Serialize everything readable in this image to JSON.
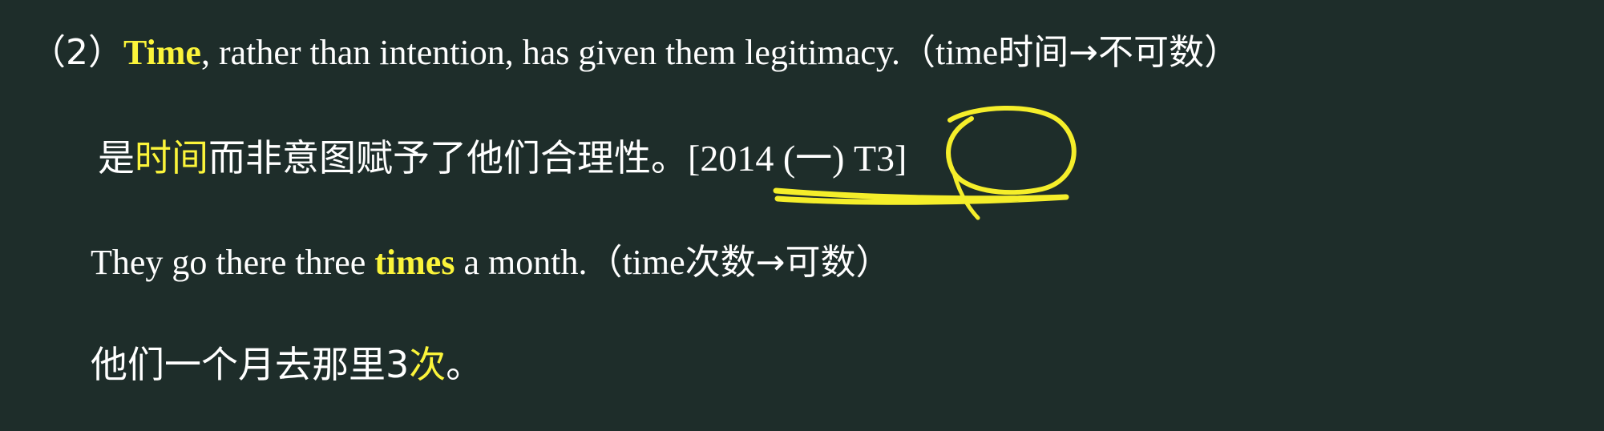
{
  "example1": {
    "number": "（2）",
    "keyword": "Time",
    "rest": ", rather than intention, has given them legitimacy.",
    "note_open": "（time",
    "note_cn": "时间→不可数",
    "note_close": "）"
  },
  "translation1": {
    "pre": "是",
    "highlight": "时间",
    "post": "而非意图赋予了他们合理性。",
    "citation": "[2014 (一) T3]"
  },
  "example2": {
    "pre": "They go there three ",
    "keyword": "times",
    "post": " a month.",
    "note_open": "（time",
    "note_cn": "次数→可数",
    "note_close": "）"
  },
  "translation2": {
    "pre": "他们一个月去那里3",
    "highlight": "次",
    "post": "。"
  },
  "colors": {
    "background": "#1e2d2a",
    "text": "#ffffff",
    "highlight": "#fbf43a",
    "annotation": "#f5ee2a"
  }
}
